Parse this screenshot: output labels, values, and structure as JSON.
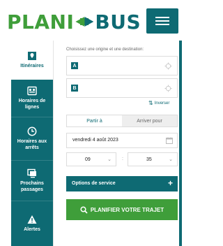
{
  "logo": {
    "part1": "PLANI",
    "part2": "BUS"
  },
  "sidebar": {
    "items": [
      {
        "label": "Itinéraires",
        "icon": "map-pin-icon",
        "active": true
      },
      {
        "label": "Horaires de lignes",
        "icon": "timetable-icon"
      },
      {
        "label": "Horaires aux arrêts",
        "icon": "clock-icon"
      },
      {
        "label": "Prochains passages",
        "icon": "monitor-icon"
      },
      {
        "label": "Alertes",
        "icon": "warning-icon"
      }
    ]
  },
  "planner": {
    "hint": "Choisissez une origine et une destination:",
    "origin": {
      "badge": "A",
      "value": "",
      "placeholder": ""
    },
    "destination": {
      "badge": "B",
      "value": "",
      "placeholder": ""
    },
    "swap_label": "Inverser",
    "mode": {
      "depart": "Partir à",
      "arrive": "Arriver pour",
      "selected": "depart"
    },
    "date": "vendredi 4 août 2023",
    "hour": "09",
    "minute": "35",
    "options_label": "Options de service",
    "options_icon": "+",
    "submit_label": "PLANIFIER VOTRE TRAJET"
  },
  "colors": {
    "brand_teal": "#0e6a73",
    "brand_green": "#3f9e3a"
  }
}
